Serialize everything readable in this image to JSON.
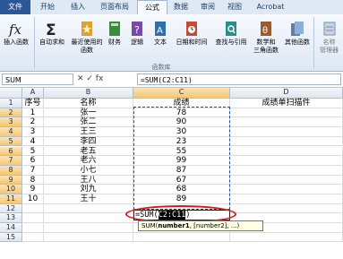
{
  "ribbon_tabs": [
    "文件",
    "开始",
    "插入",
    "页面布局",
    "公式",
    "数据",
    "审阅",
    "视图",
    "Acrobat"
  ],
  "active_tab": "公式",
  "ribbon_buttons": [
    {
      "label": "插入函数",
      "icon": "fx-icon"
    },
    {
      "label": "自动求和",
      "icon": "sigma-icon"
    },
    {
      "label": "最近使用的\n函数",
      "icon": "star-book-icon"
    },
    {
      "label": "财务",
      "icon": "book-icon"
    },
    {
      "label": "逻辑",
      "icon": "book-question-icon"
    },
    {
      "label": "文本",
      "icon": "book-a-icon"
    },
    {
      "label": "日期和时间",
      "icon": "book-clock-icon"
    },
    {
      "label": "查找与引用",
      "icon": "book-search-icon"
    },
    {
      "label": "数学和\n三角函数",
      "icon": "book-theta-icon"
    },
    {
      "label": "其他函数",
      "icon": "book-more-icon"
    },
    {
      "label": "名称\n管理器",
      "icon": "tag-icon"
    }
  ],
  "ribbon_group_label": "函数库",
  "name_box": "SUM",
  "formula_bar": "=SUM(C2:C11)",
  "formula_tools": "✕ ✓ fx",
  "columns": [
    "A",
    "B",
    "C",
    "D"
  ],
  "rows": [
    {
      "n": "1",
      "a": "序号",
      "b": "名称",
      "c": "成绩",
      "d": "成绩单扫描件"
    },
    {
      "n": "2",
      "a": "1",
      "b": "张一",
      "c": "78",
      "d": ""
    },
    {
      "n": "3",
      "a": "2",
      "b": "张二",
      "c": "90",
      "d": ""
    },
    {
      "n": "4",
      "a": "3",
      "b": "王三",
      "c": "30",
      "d": ""
    },
    {
      "n": "5",
      "a": "4",
      "b": "李四",
      "c": "23",
      "d": ""
    },
    {
      "n": "6",
      "a": "5",
      "b": "老五",
      "c": "55",
      "d": ""
    },
    {
      "n": "7",
      "a": "6",
      "b": "老六",
      "c": "99",
      "d": ""
    },
    {
      "n": "8",
      "a": "7",
      "b": "小七",
      "c": "87",
      "d": ""
    },
    {
      "n": "9",
      "a": "8",
      "b": "王八",
      "c": "67",
      "d": ""
    },
    {
      "n": "10",
      "a": "9",
      "b": "刘九",
      "c": "68",
      "d": ""
    },
    {
      "n": "11",
      "a": "10",
      "b": "王十",
      "c": "89",
      "d": ""
    },
    {
      "n": "12",
      "a": "",
      "b": "",
      "c": "",
      "d": ""
    },
    {
      "n": "13",
      "a": "",
      "b": "",
      "c": "",
      "d": ""
    },
    {
      "n": "14",
      "a": "",
      "b": "",
      "c": "",
      "d": ""
    },
    {
      "n": "15",
      "a": "",
      "b": "",
      "c": "",
      "d": ""
    }
  ],
  "editing_cell": {
    "prefix": "=SUM(",
    "highlight": "C2:C11",
    "suffix": ")"
  },
  "tooltip": {
    "fn": "SUM(",
    "arg1": "number1",
    "rest": ", [number2], ...)"
  },
  "colors": {
    "accent": "#2b5797",
    "annotation": "#e01818",
    "selection": "#1e4f9c"
  }
}
